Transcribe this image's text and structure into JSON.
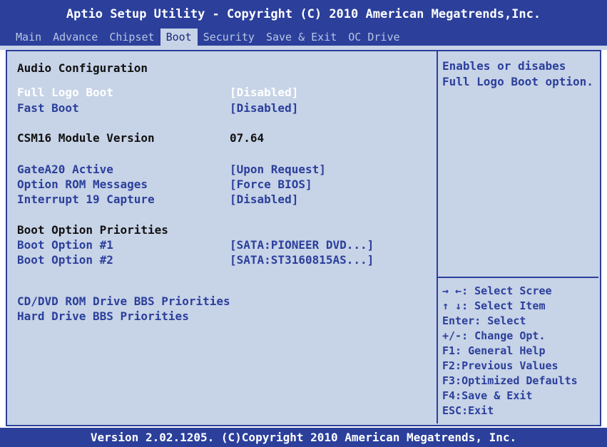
{
  "header": {
    "title": "Aptio Setup Utility - Copyright (C) 2010 American Megatrends,Inc."
  },
  "menu": {
    "tabs": [
      {
        "label": "Main"
      },
      {
        "label": "Advance"
      },
      {
        "label": "Chipset"
      },
      {
        "label": "Boot"
      },
      {
        "label": "Security"
      },
      {
        "label": "Save & Exit"
      },
      {
        "label": "OC Drive"
      }
    ],
    "active": "Boot"
  },
  "settings": {
    "audio_heading": "Audio Configuration",
    "full_logo_boot": {
      "label": "Full Logo Boot",
      "value": "[Disabled]"
    },
    "fast_boot": {
      "label": "Fast Boot",
      "value": "[Disabled]"
    },
    "csm16": {
      "label": "CSM16 Module Version",
      "value": "07.64"
    },
    "gatea20": {
      "label": "GateA20 Active",
      "value": "[Upon Request]"
    },
    "option_rom": {
      "label": "Option ROM Messages",
      "value": "[Force BIOS]"
    },
    "interrupt19": {
      "label": "Interrupt 19 Capture",
      "value": "[Disabled]"
    },
    "boot_priorities_heading": "Boot Option Priorities",
    "boot1": {
      "label": "Boot Option #1",
      "value": "[SATA:PIONEER DVD...]"
    },
    "boot2": {
      "label": "Boot Option #2",
      "value": "[SATA:ST3160815AS...]"
    },
    "cd_dvd_bbs": "CD/DVD ROM Drive BBS Priorities",
    "hdd_bbs": "Hard Drive BBS Priorities"
  },
  "help": {
    "text": "Enables or disabes\nFull Logo Boot option."
  },
  "keys": [
    "→ ←:  Select Scree",
    "↑ ↓:  Select Item",
    "Enter: Select",
    "+/-:  Change Opt.",
    "F1: General Help",
    "F2:Previous Values",
    "F3:Optimized Defaults",
    "F4:Save & Exit",
    "ESC:Exit"
  ],
  "footer": {
    "text": "Version 2.02.1205. (C)Copyright 2010 American Megatrends, Inc."
  },
  "colors": {
    "bar": "#2b3f9b",
    "panel": "#c7d3e7",
    "selected": "#ffffff"
  }
}
